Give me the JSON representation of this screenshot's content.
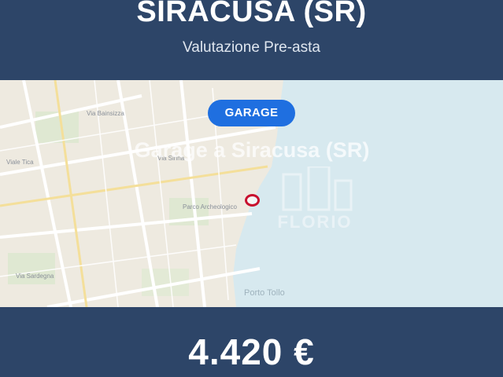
{
  "header": {
    "city": "SIRACUSA (SR)",
    "subtitle": "Valutazione Pre-asta"
  },
  "listing": {
    "category_badge": "GARAGE",
    "title": "Garage a Siracusa (SR)",
    "price": "4.420 €"
  },
  "map": {
    "watermark": "FLORIO",
    "sea_label": "Porto Tollo",
    "street_labels": [
      "Via Bainsizza",
      "Viale Tica",
      "Via Sirina",
      "Parco Archeologico",
      "Via Sardegna"
    ],
    "marker_color": "#c8102e",
    "land_color": "#eeeae0",
    "sea_color": "#d7e9ef"
  },
  "colors": {
    "brand_navy": "#2d4568",
    "badge_blue": "#1f6fe0"
  }
}
